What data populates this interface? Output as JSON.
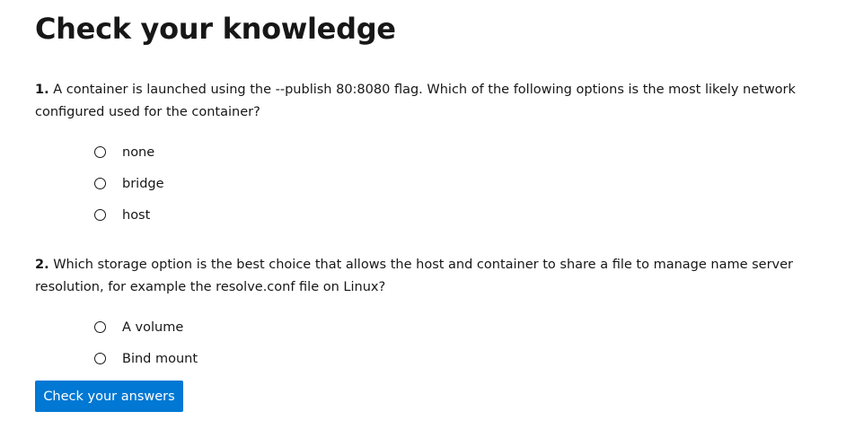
{
  "title": "Check your knowledge",
  "questions": [
    {
      "number": "1.",
      "text": "A container is launched using the --publish 80:8080 flag. Which of the following options is the most likely network configured used for the container?",
      "options": [
        "none",
        "bridge",
        "host"
      ]
    },
    {
      "number": "2.",
      "text": "Which storage option is the best choice that allows the host and container to share a file to manage name server resolution, for example the resolve.conf file on Linux?",
      "options": [
        "A volume",
        "Bind mount"
      ]
    }
  ],
  "submit_label": "Check your answers",
  "colors": {
    "accent": "#0078d4",
    "text": "#171717"
  }
}
